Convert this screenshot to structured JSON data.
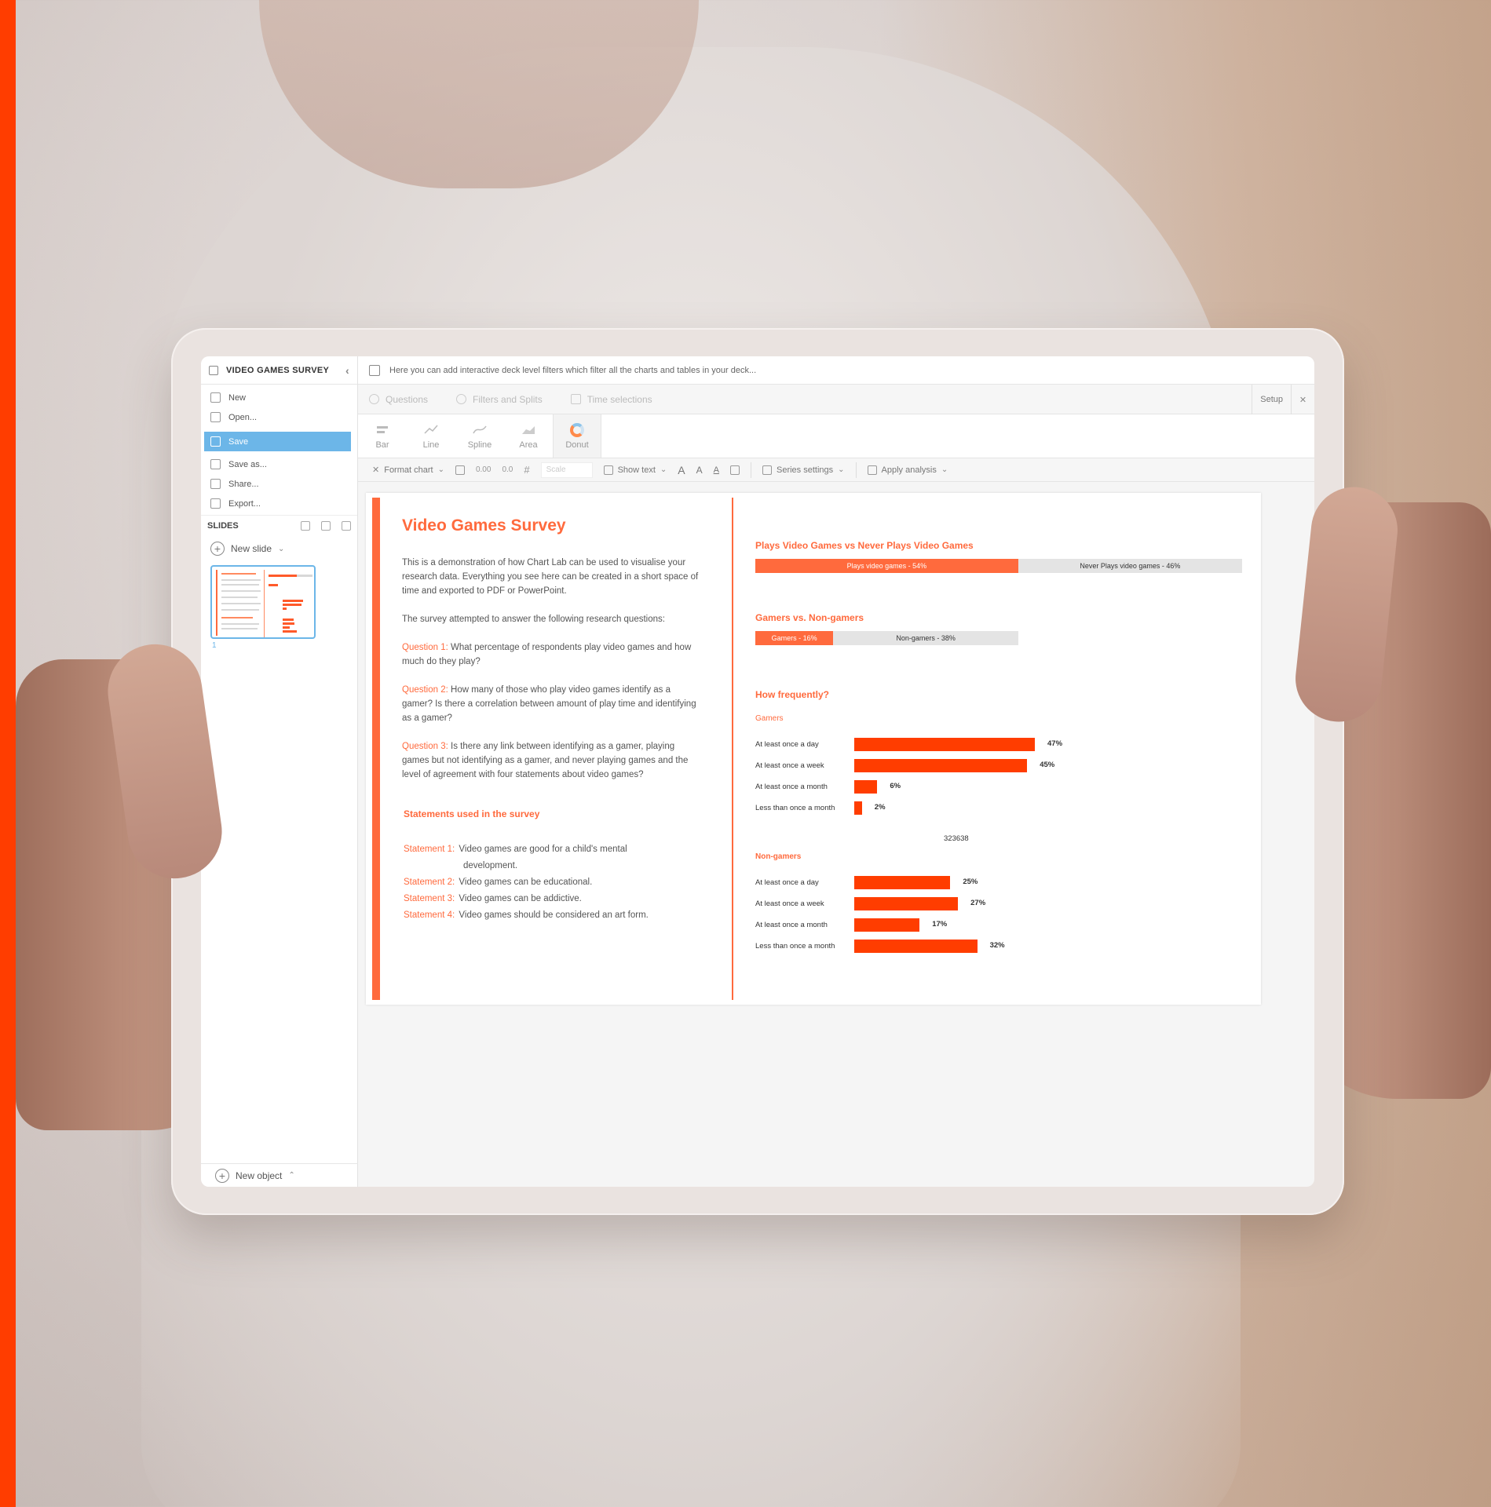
{
  "app": {
    "deck_title": "VIDEO GAMES SURVEY",
    "filter_hint": "Here you can add interactive deck level filters which filter all the charts and tables in your deck..."
  },
  "file_menu": [
    {
      "label": "New",
      "icon": "new-file-icon"
    },
    {
      "label": "Open...",
      "icon": "folder-icon"
    },
    {
      "label": "Save",
      "icon": "save-icon",
      "active": true
    },
    {
      "label": "Save as...",
      "icon": "save-as-icon"
    },
    {
      "label": "Share...",
      "icon": "share-icon"
    },
    {
      "label": "Export...",
      "icon": "export-icon"
    }
  ],
  "slides_panel": {
    "heading": "SLIDES",
    "new_slide": "New slide",
    "thumb_number": "1",
    "new_object": "New object"
  },
  "tabs": [
    "Questions",
    "Filters and Splits",
    "Time selections"
  ],
  "setup_label": "Setup",
  "chart_types": [
    "Bar",
    "Line",
    "Spline",
    "Area",
    "Donut"
  ],
  "format_toolbar": {
    "format_chart": "Format chart",
    "dec_plus": "0.00",
    "dec_minus": "0.0",
    "hash": "#",
    "scale_placeholder": "Scale",
    "show_text": "Show text",
    "font_up": "A",
    "font_down": "A",
    "series_settings": "Series settings",
    "apply_analysis": "Apply analysis"
  },
  "colors": {
    "accent": "#ff6a3d",
    "bar": "#ff3d00",
    "selection": "#6cb6e8"
  },
  "slide": {
    "title": "Video Games Survey",
    "intro": "This is a demonstration of how Chart Lab can be used to visualise your research data. Everything you see here can be created in a short space of time and exported to PDF or PowerPoint.",
    "lead": "The survey attempted to answer the following research questions:",
    "questions": [
      {
        "label": "Question 1:",
        "text": "What percentage of respondents play video games and how much do they play?"
      },
      {
        "label": "Question 2:",
        "text": "How many of those who play video games identify as a gamer? Is there a correlation between amount of play time and identifying as a gamer?"
      },
      {
        "label": "Question 3:",
        "text": "Is there any link between identifying as a gamer, playing games but not identifying as a gamer, and never playing games and the level of agreement with four statements about video games?"
      }
    ],
    "statements_heading": "Statements used in the survey",
    "statements": [
      {
        "label": "Statement 1:",
        "text": "Video games are good for a child's mental",
        "text2": "development."
      },
      {
        "label": "Statement 2:",
        "text": "Video games can be educational."
      },
      {
        "label": "Statement 3:",
        "text": "Video games can be addictive."
      },
      {
        "label": "Statement 4:",
        "text": "Video games should be considered an art form."
      }
    ]
  },
  "chart_data": [
    {
      "type": "bar",
      "title": "Plays Video Games vs Never Plays Video Games",
      "stacked": true,
      "segments": [
        {
          "label": "Plays video games - 54%",
          "value": 54
        },
        {
          "label": "Never Plays video games - 46%",
          "value": 46
        }
      ]
    },
    {
      "type": "bar",
      "title": "Gamers vs. Non-gamers",
      "stacked": true,
      "segments": [
        {
          "label": "Gamers - 16%",
          "value": 16
        },
        {
          "label": "Non-gamers - 38%",
          "value": 38
        }
      ]
    },
    {
      "type": "bar",
      "title": "How frequently?",
      "subtitle": "Gamers",
      "orientation": "horizontal",
      "categories": [
        "At least once a day",
        "At least once a week",
        "At least once a month",
        "Less than once a month"
      ],
      "values": [
        47,
        45,
        6,
        2
      ],
      "value_labels": [
        "47%",
        "45%",
        "6%",
        "2%"
      ]
    },
    {
      "type": "bar",
      "subtitle": "Non-gamers",
      "orientation": "horizontal",
      "categories": [
        "At least once a day",
        "At least once a week",
        "At least once a month",
        "Less than once a month"
      ],
      "values": [
        25,
        27,
        17,
        32
      ],
      "value_labels": [
        "25%",
        "27%",
        "17%",
        "32%"
      ]
    }
  ],
  "stray_text": "323638"
}
